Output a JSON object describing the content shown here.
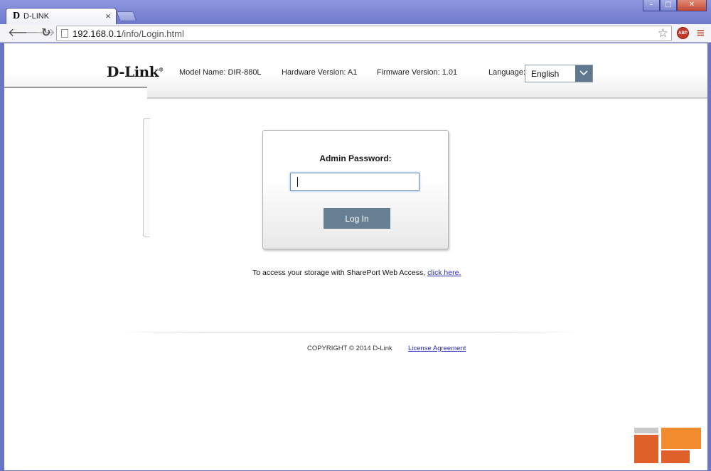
{
  "browser": {
    "tab_title": "D-LINK",
    "tab_favicon": "D",
    "tab_close": "×",
    "url_host": "192.168.0.1",
    "url_path": "/info/Login.html",
    "adblock_label": "ABP",
    "window_buttons": {
      "minimize": "–",
      "maximize": "□",
      "close": "✕"
    }
  },
  "header": {
    "logo": "D-Link",
    "model_name": "Model Name: DIR-880L",
    "hardware_version": "Hardware Version: A1",
    "firmware_version": "Firmware Version: 1.01",
    "language_label": "Language:",
    "language_value": "English"
  },
  "login": {
    "password_label": "Admin Password:",
    "password_value": "",
    "button_label": "Log In"
  },
  "sharepoint": {
    "text": "To access your storage with SharePort Web Access, ",
    "link": "click here."
  },
  "footer": {
    "copyright": "COPYRIGHT © 2014 D-Link",
    "license": "License Agreement"
  },
  "colors": {
    "chrome_frame": "#6a74c8",
    "button": "#677f93",
    "link": "#2a2abf",
    "select_arrow": "#5f7890"
  },
  "icons": [
    "back-arrow-icon",
    "forward-arrow-icon",
    "reload-icon",
    "page-icon",
    "star-icon",
    "adblock-icon",
    "menu-icon",
    "chevron-down-icon",
    "watermark-logo-icon"
  ]
}
